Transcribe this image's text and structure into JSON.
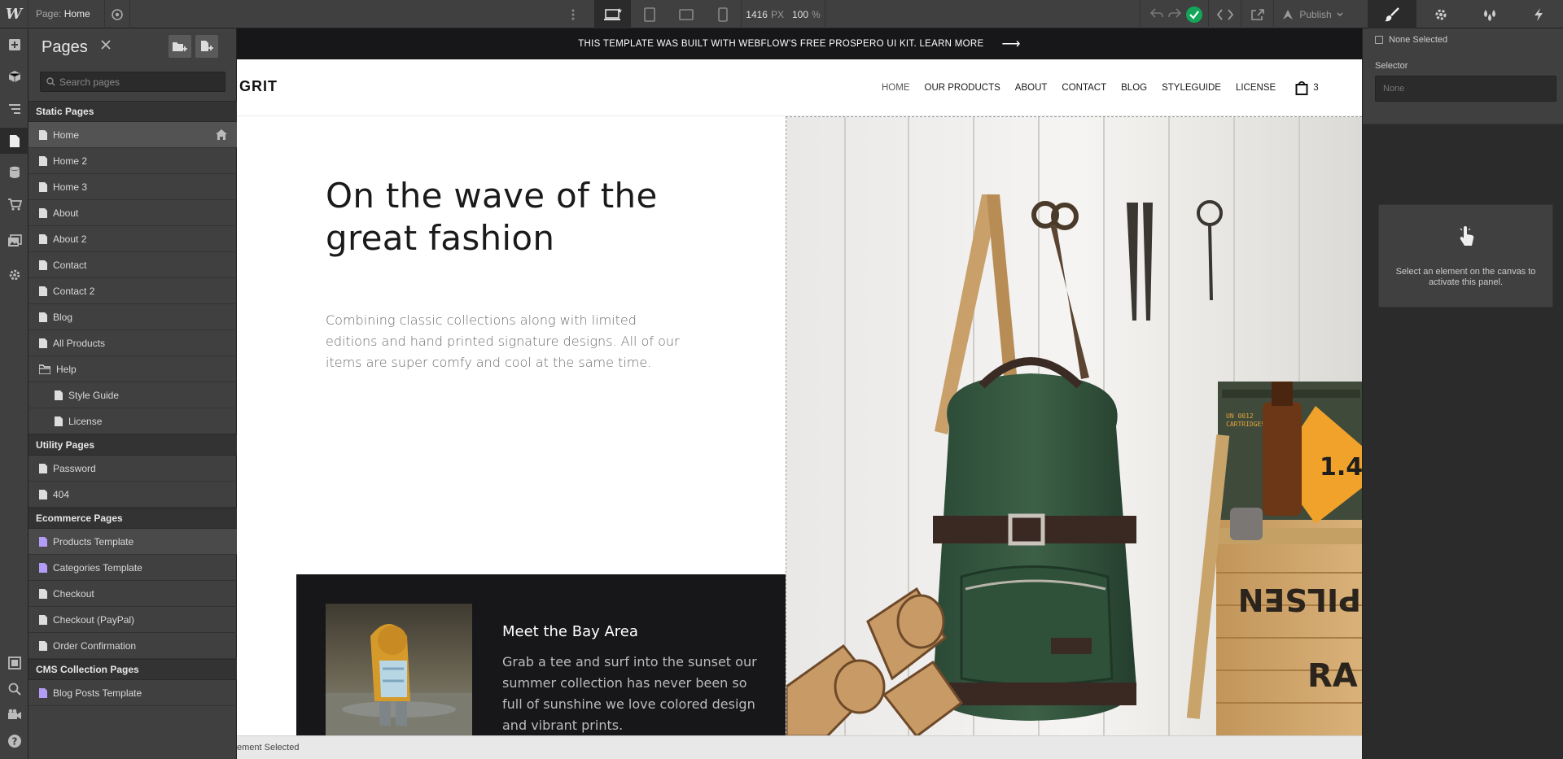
{
  "topbar": {
    "logo": "W",
    "page_prefix": "Page:",
    "page_name": "Home",
    "width_value": "1416",
    "width_unit": "PX",
    "zoom_value": "100",
    "zoom_unit": "%",
    "publish_label": "Publish"
  },
  "pages_panel": {
    "title": "Pages",
    "search_placeholder": "Search pages",
    "sections": [
      {
        "label": "Static Pages"
      },
      {
        "label": "Utility Pages"
      },
      {
        "label": "Ecommerce Pages"
      },
      {
        "label": "CMS Collection Pages"
      }
    ],
    "static": [
      "Home",
      "Home 2",
      "Home 3",
      "About",
      "About 2",
      "Contact",
      "Contact 2",
      "Blog",
      "All Products",
      "Help",
      "Style Guide",
      "License"
    ],
    "utility": [
      "Password",
      "404"
    ],
    "ecommerce": [
      "Products Template",
      "Categories Template",
      "Checkout",
      "Checkout (PayPal)",
      "Order Confirmation"
    ],
    "cms": [
      "Blog Posts Template"
    ]
  },
  "site": {
    "banner": "THIS TEMPLATE WAS BUILT WITH WEBFLOW'S FREE PROSPERO UI KIT. LEARN MORE",
    "banner_arrow": "⟶",
    "brand": "GRIT",
    "nav": [
      "HOME",
      "OUR PRODUCTS",
      "ABOUT",
      "CONTACT",
      "BLOG",
      "STYLEGUIDE",
      "LICENSE"
    ],
    "cart_count": "3",
    "hero_title": "On the wave of the great fashion",
    "hero_text": "Combining classic collections along with limited editions and hand printed signature designs. All of our items are super comfy and cool at the same time.",
    "card_title": "Meet the Bay Area",
    "card_text": "Grab a tee and surf into the sunset our summer collection has never been so full of sunshine we love colored design and vibrant prints."
  },
  "statusbar": {
    "text": "ement Selected"
  },
  "right_panel": {
    "none_selected": "None Selected",
    "selector_label": "Selector",
    "selector_placeholder": "None",
    "hint": "Select an element on the canvas to activate this panel."
  },
  "colors": {
    "chrome": "#404040",
    "chrome_dark": "#2b2b2b",
    "ok_green": "#13a65a",
    "ecommerce_icon": "#b39cf5"
  }
}
